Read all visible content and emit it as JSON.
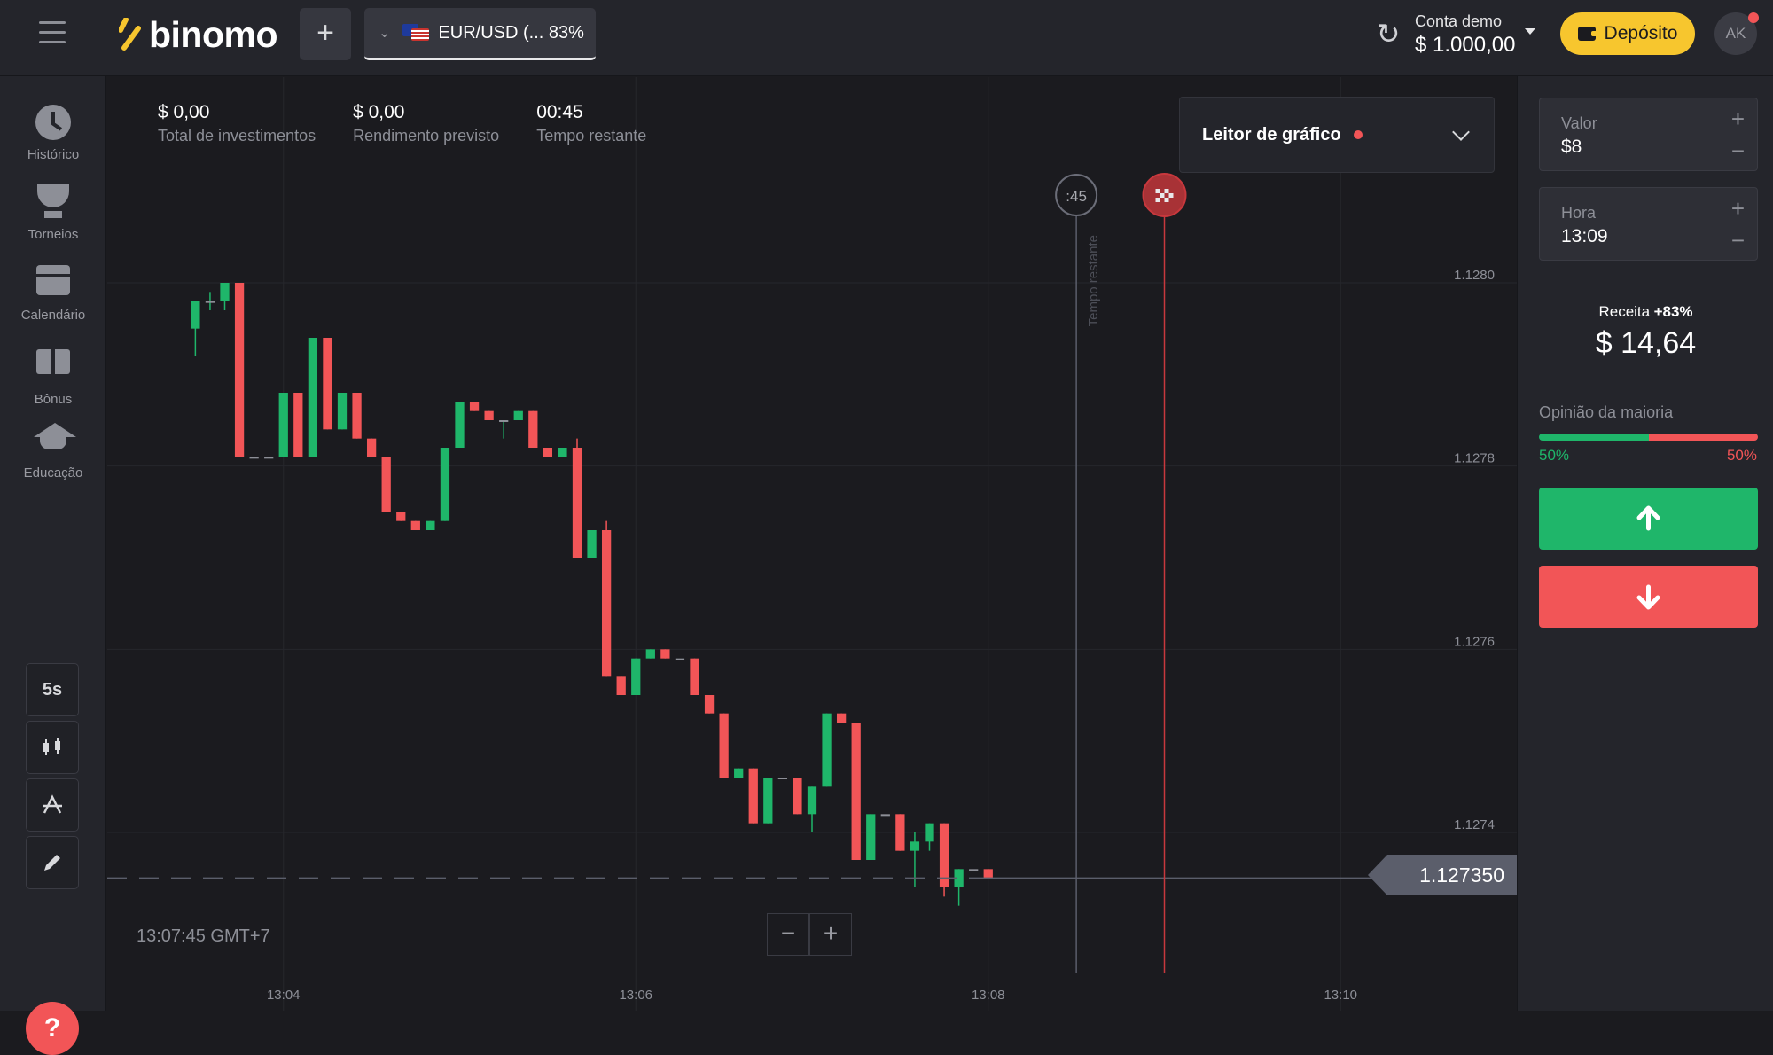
{
  "header": {
    "logo_text": "binomo",
    "add_asset": "+",
    "asset_label": "EUR/USD (... 83%",
    "account_label": "Conta demo",
    "account_balance": "$ 1.000,00",
    "deposit_label": "Depósito",
    "avatar_initials": "AK"
  },
  "sidebar": {
    "items": [
      {
        "label": "Histórico",
        "icon": "clock-icon"
      },
      {
        "label": "Torneios",
        "icon": "trophy-icon"
      },
      {
        "label": "Calendário",
        "icon": "calendar-icon"
      },
      {
        "label": "Bônus",
        "icon": "gift-icon"
      },
      {
        "label": "Educação",
        "icon": "graduation-cap-icon"
      }
    ],
    "tools": {
      "timeframe": "5s"
    },
    "help": "?"
  },
  "stats": [
    {
      "value": "$ 0,00",
      "label": "Total de investimentos"
    },
    {
      "value": "$ 0,00",
      "label": "Rendimento previsto"
    },
    {
      "value": "00:45",
      "label": "Tempo restante"
    }
  ],
  "chart_reader": {
    "label": "Leitor de gráfico"
  },
  "chart_data": {
    "type": "candlestick",
    "price_axis_ticks": [
      "1.1280",
      "1.1278",
      "1.1276",
      "1.1274"
    ],
    "time_axis_ticks": [
      "13:04",
      "13:06",
      "13:08",
      "13:10"
    ],
    "current_price": "1.127350",
    "timer_label": ":45",
    "vertical_label": "Tempo restante",
    "clock_readout": "13:07:45 GMT+7",
    "ylim": [
      1.12725,
      1.12835
    ],
    "xlim": [
      "13:03:00",
      "13:11:00"
    ],
    "candles": [
      {
        "t": "13:03:30",
        "o": 1.12795,
        "h": 1.12798,
        "l": 1.12792,
        "c": 1.12798
      },
      {
        "t": "13:03:35",
        "o": 1.12798,
        "h": 1.12799,
        "l": 1.12797,
        "c": 1.12798
      },
      {
        "t": "13:03:40",
        "o": 1.12798,
        "h": 1.128,
        "l": 1.12797,
        "c": 1.128
      },
      {
        "t": "13:03:45",
        "o": 1.128,
        "h": 1.128,
        "l": 1.12781,
        "c": 1.12781
      },
      {
        "t": "13:03:50",
        "o": 1.12781,
        "h": 1.12781,
        "l": 1.12781,
        "c": 1.12781
      },
      {
        "t": "13:03:55",
        "o": 1.12781,
        "h": 1.12781,
        "l": 1.12781,
        "c": 1.12781
      },
      {
        "t": "13:04:00",
        "o": 1.12781,
        "h": 1.12788,
        "l": 1.12781,
        "c": 1.12788
      },
      {
        "t": "13:04:05",
        "o": 1.12788,
        "h": 1.12788,
        "l": 1.12781,
        "c": 1.12781
      },
      {
        "t": "13:04:10",
        "o": 1.12781,
        "h": 1.12794,
        "l": 1.12781,
        "c": 1.12794
      },
      {
        "t": "13:04:15",
        "o": 1.12794,
        "h": 1.12794,
        "l": 1.12784,
        "c": 1.12784
      },
      {
        "t": "13:04:20",
        "o": 1.12784,
        "h": 1.12788,
        "l": 1.12784,
        "c": 1.12788
      },
      {
        "t": "13:04:25",
        "o": 1.12788,
        "h": 1.12788,
        "l": 1.12783,
        "c": 1.12783
      },
      {
        "t": "13:04:30",
        "o": 1.12783,
        "h": 1.12783,
        "l": 1.12781,
        "c": 1.12781
      },
      {
        "t": "13:04:35",
        "o": 1.12781,
        "h": 1.12781,
        "l": 1.12775,
        "c": 1.12775
      },
      {
        "t": "13:04:40",
        "o": 1.12775,
        "h": 1.12775,
        "l": 1.12774,
        "c": 1.12774
      },
      {
        "t": "13:04:45",
        "o": 1.12774,
        "h": 1.12774,
        "l": 1.12773,
        "c": 1.12773
      },
      {
        "t": "13:04:50",
        "o": 1.12773,
        "h": 1.12774,
        "l": 1.12773,
        "c": 1.12774
      },
      {
        "t": "13:04:55",
        "o": 1.12774,
        "h": 1.12782,
        "l": 1.12774,
        "c": 1.12782
      },
      {
        "t": "13:05:00",
        "o": 1.12782,
        "h": 1.12787,
        "l": 1.12782,
        "c": 1.12787
      },
      {
        "t": "13:05:05",
        "o": 1.12787,
        "h": 1.12787,
        "l": 1.12786,
        "c": 1.12786
      },
      {
        "t": "13:05:10",
        "o": 1.12786,
        "h": 1.12786,
        "l": 1.12785,
        "c": 1.12785
      },
      {
        "t": "13:05:15",
        "o": 1.12785,
        "h": 1.12785,
        "l": 1.12783,
        "c": 1.12785
      },
      {
        "t": "13:05:20",
        "o": 1.12785,
        "h": 1.12786,
        "l": 1.12785,
        "c": 1.12786
      },
      {
        "t": "13:05:25",
        "o": 1.12786,
        "h": 1.12786,
        "l": 1.12782,
        "c": 1.12782
      },
      {
        "t": "13:05:30",
        "o": 1.12782,
        "h": 1.12782,
        "l": 1.12781,
        "c": 1.12781
      },
      {
        "t": "13:05:35",
        "o": 1.12781,
        "h": 1.12782,
        "l": 1.12781,
        "c": 1.12782
      },
      {
        "t": "13:05:40",
        "o": 1.12782,
        "h": 1.12783,
        "l": 1.1277,
        "c": 1.1277
      },
      {
        "t": "13:05:45",
        "o": 1.1277,
        "h": 1.12773,
        "l": 1.1277,
        "c": 1.12773
      },
      {
        "t": "13:05:50",
        "o": 1.12773,
        "h": 1.12774,
        "l": 1.12757,
        "c": 1.12757
      },
      {
        "t": "13:05:55",
        "o": 1.12757,
        "h": 1.12757,
        "l": 1.12755,
        "c": 1.12755
      },
      {
        "t": "13:06:00",
        "o": 1.12755,
        "h": 1.12759,
        "l": 1.12755,
        "c": 1.12759
      },
      {
        "t": "13:06:05",
        "o": 1.12759,
        "h": 1.1276,
        "l": 1.12759,
        "c": 1.1276
      },
      {
        "t": "13:06:10",
        "o": 1.1276,
        "h": 1.1276,
        "l": 1.12759,
        "c": 1.12759
      },
      {
        "t": "13:06:15",
        "o": 1.12759,
        "h": 1.12759,
        "l": 1.12759,
        "c": 1.12759
      },
      {
        "t": "13:06:20",
        "o": 1.12759,
        "h": 1.12759,
        "l": 1.12755,
        "c": 1.12755
      },
      {
        "t": "13:06:25",
        "o": 1.12755,
        "h": 1.12755,
        "l": 1.12753,
        "c": 1.12753
      },
      {
        "t": "13:06:30",
        "o": 1.12753,
        "h": 1.12753,
        "l": 1.12746,
        "c": 1.12746
      },
      {
        "t": "13:06:35",
        "o": 1.12746,
        "h": 1.12747,
        "l": 1.12746,
        "c": 1.12747
      },
      {
        "t": "13:06:40",
        "o": 1.12747,
        "h": 1.12747,
        "l": 1.12741,
        "c": 1.12741
      },
      {
        "t": "13:06:45",
        "o": 1.12741,
        "h": 1.12746,
        "l": 1.12741,
        "c": 1.12746
      },
      {
        "t": "13:06:50",
        "o": 1.12746,
        "h": 1.12746,
        "l": 1.12746,
        "c": 1.12746
      },
      {
        "t": "13:06:55",
        "o": 1.12746,
        "h": 1.12746,
        "l": 1.12742,
        "c": 1.12742
      },
      {
        "t": "13:07:00",
        "o": 1.12742,
        "h": 1.12745,
        "l": 1.1274,
        "c": 1.12745
      },
      {
        "t": "13:07:05",
        "o": 1.12745,
        "h": 1.12753,
        "l": 1.12745,
        "c": 1.12753
      },
      {
        "t": "13:07:10",
        "o": 1.12753,
        "h": 1.12753,
        "l": 1.12752,
        "c": 1.12752
      },
      {
        "t": "13:07:15",
        "o": 1.12752,
        "h": 1.12752,
        "l": 1.12737,
        "c": 1.12737
      },
      {
        "t": "13:07:20",
        "o": 1.12737,
        "h": 1.12742,
        "l": 1.12737,
        "c": 1.12742
      },
      {
        "t": "13:07:25",
        "o": 1.12742,
        "h": 1.12742,
        "l": 1.12742,
        "c": 1.12742
      },
      {
        "t": "13:07:30",
        "o": 1.12742,
        "h": 1.12742,
        "l": 1.12738,
        "c": 1.12738
      },
      {
        "t": "13:07:35",
        "o": 1.12738,
        "h": 1.1274,
        "l": 1.12734,
        "c": 1.12739
      },
      {
        "t": "13:07:40",
        "o": 1.12739,
        "h": 1.12741,
        "l": 1.12738,
        "c": 1.12741
      },
      {
        "t": "13:07:45",
        "o": 1.12741,
        "h": 1.12741,
        "l": 1.12733,
        "c": 1.12734
      },
      {
        "t": "13:07:50",
        "o": 1.12734,
        "h": 1.12736,
        "l": 1.12732,
        "c": 1.12736
      },
      {
        "t": "13:07:55",
        "o": 1.12736,
        "h": 1.12736,
        "l": 1.12736,
        "c": 1.12736
      },
      {
        "t": "13:08:00",
        "o": 1.12736,
        "h": 1.12736,
        "l": 1.12735,
        "c": 1.12735
      }
    ]
  },
  "zoom": {
    "minus": "−",
    "plus": "+"
  },
  "trade": {
    "amount_label": "Valor",
    "amount_value": "$8",
    "time_label": "Hora",
    "time_value": "13:09",
    "revenue_label": "Receita",
    "revenue_pct": "+83%",
    "revenue_value": "$ 14,64",
    "majority_label": "Opinião da maioria",
    "majority_up": "50%",
    "majority_down": "50%",
    "majority_up_fraction": 0.5
  },
  "colors": {
    "up": "#1fb66a",
    "down": "#f25557",
    "accent": "#f7c62e"
  }
}
